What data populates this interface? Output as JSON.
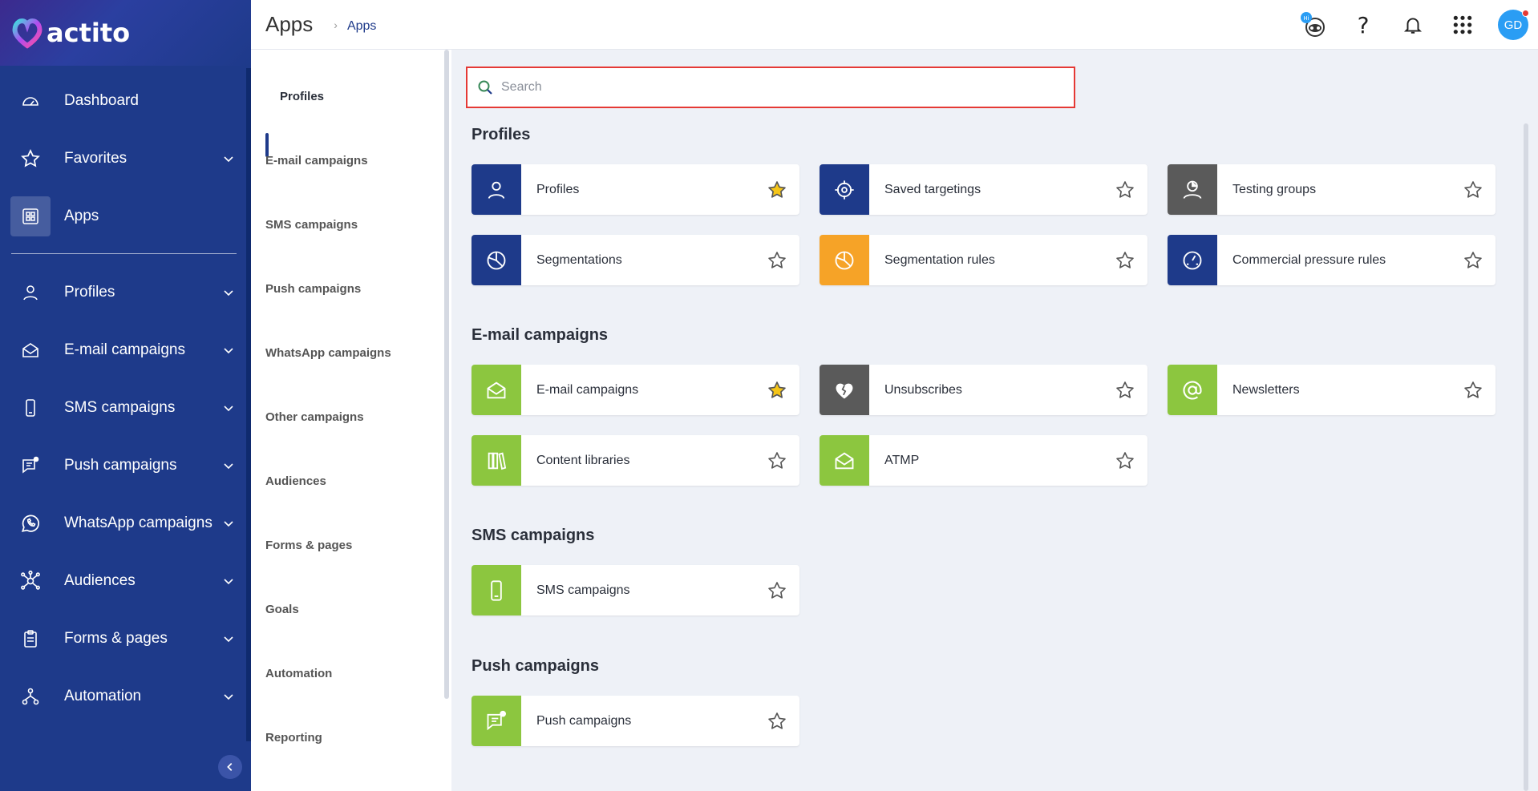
{
  "brand": {
    "name": "actito"
  },
  "topbar": {
    "title": "Apps",
    "breadcrumb": "Apps",
    "avatar_initials": "GD",
    "help_label": "?"
  },
  "sidebar": {
    "items": [
      {
        "label": "Dashboard",
        "icon": "gauge-icon"
      },
      {
        "label": "Favorites",
        "icon": "star-icon"
      },
      {
        "label": "Apps",
        "icon": "apps-grid-icon"
      },
      {
        "label": "Profiles",
        "icon": "user-icon"
      },
      {
        "label": "E-mail campaigns",
        "icon": "envelope-icon"
      },
      {
        "label": "SMS campaigns",
        "icon": "phone-icon"
      },
      {
        "label": "Push campaigns",
        "icon": "push-icon"
      },
      {
        "label": "WhatsApp campaigns",
        "icon": "whatsapp-icon"
      },
      {
        "label": "Audiences",
        "icon": "network-icon"
      },
      {
        "label": "Forms & pages",
        "icon": "clipboard-icon"
      },
      {
        "label": "Automation",
        "icon": "flow-icon"
      }
    ]
  },
  "subnav": {
    "items": [
      "Profiles",
      "E-mail campaigns",
      "SMS campaigns",
      "Push campaigns",
      "WhatsApp campaigns",
      "Other campaigns",
      "Audiences",
      "Forms & pages",
      "Goals",
      "Automation",
      "Reporting"
    ]
  },
  "search": {
    "placeholder": "Search"
  },
  "sections": [
    {
      "title": "Profiles"
    },
    {
      "title": "E-mail campaigns"
    },
    {
      "title": "SMS campaigns"
    },
    {
      "title": "Push campaigns"
    }
  ],
  "apps": [
    {
      "name": "Profiles",
      "color": "#1e3a8a",
      "favorite": true
    },
    {
      "name": "Saved targetings",
      "color": "#1e3a8a",
      "favorite": false
    },
    {
      "name": "Testing groups",
      "color": "#5a5a5a",
      "favorite": false
    },
    {
      "name": "Segmentations",
      "color": "#1e3a8a",
      "favorite": false
    },
    {
      "name": "Segmentation rules",
      "color": "#f6a327",
      "favorite": false
    },
    {
      "name": "Commercial pressure rules",
      "color": "#1e3a8a",
      "favorite": false
    },
    {
      "name": "E-mail campaigns",
      "color": "#8cc63f",
      "favorite": true
    },
    {
      "name": "Unsubscribes",
      "color": "#5a5a5a",
      "favorite": false
    },
    {
      "name": "Newsletters",
      "color": "#8cc63f",
      "favorite": false
    },
    {
      "name": "Content libraries",
      "color": "#8cc63f",
      "favorite": false
    },
    {
      "name": "ATMP",
      "color": "#8cc63f",
      "favorite": false
    },
    {
      "name": "SMS campaigns",
      "color": "#8cc63f",
      "favorite": false
    },
    {
      "name": "Push campaigns",
      "color": "#8cc63f",
      "favorite": false
    }
  ]
}
